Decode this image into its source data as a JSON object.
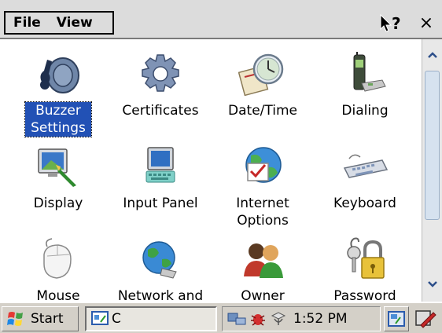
{
  "menu": {
    "file_label": "File",
    "view_label": "View"
  },
  "controls": {
    "close_glyph": "×"
  },
  "items": [
    {
      "label": "Buzzer Settings",
      "icon": "buzzer-icon",
      "selected": true
    },
    {
      "label": "Certificates",
      "icon": "certificates-icon"
    },
    {
      "label": "Date/Time",
      "icon": "clock-icon"
    },
    {
      "label": "Dialing",
      "icon": "dialing-icon"
    },
    {
      "label": "Display",
      "icon": "display-icon"
    },
    {
      "label": "Input Panel",
      "icon": "input-panel-icon"
    },
    {
      "label": "Internet Options",
      "icon": "internet-options-icon"
    },
    {
      "label": "Keyboard",
      "icon": "keyboard-icon"
    },
    {
      "label": "Mouse",
      "icon": "mouse-icon"
    },
    {
      "label": "Network and",
      "icon": "network-icon"
    },
    {
      "label": "Owner",
      "icon": "owner-icon"
    },
    {
      "label": "Password",
      "icon": "password-icon"
    }
  ],
  "taskbar": {
    "start_label": "Start",
    "window_label": "C",
    "clock": "1:52 PM"
  },
  "colors": {
    "selection": "#2251b5",
    "taskbar": "#d4d0c8"
  }
}
